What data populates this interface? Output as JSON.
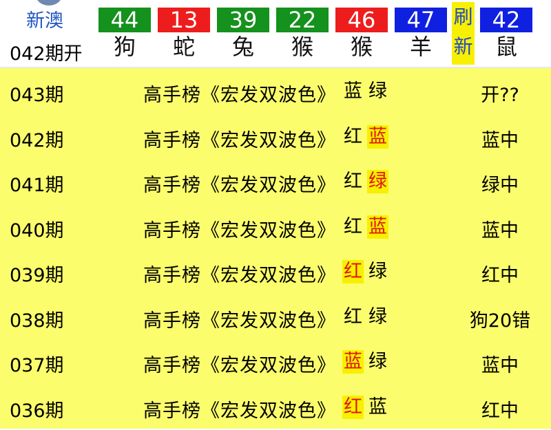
{
  "header": {
    "region": "新澳",
    "issue_open": "042期开",
    "refresh": [
      "刷",
      "新"
    ],
    "balls": [
      {
        "num": "44",
        "zodiac": "狗",
        "color": "#15911d"
      },
      {
        "num": "13",
        "zodiac": "蛇",
        "color": "#ee1d1d"
      },
      {
        "num": "39",
        "zodiac": "兔",
        "color": "#15911d"
      },
      {
        "num": "22",
        "zodiac": "猴",
        "color": "#15911d"
      },
      {
        "num": "46",
        "zodiac": "猴",
        "color": "#ee1d1d"
      },
      {
        "num": "47",
        "zodiac": "羊",
        "color": "#1020e0"
      },
      {
        "num": "42",
        "zodiac": "鼠",
        "color": "#1020e0"
      }
    ]
  },
  "rows": [
    {
      "issue": "043期",
      "prefix": "高手榜《宏发双波色》",
      "opt1": "蓝",
      "opt2": "绿",
      "hit": 0,
      "result": "开??"
    },
    {
      "issue": "042期",
      "prefix": "高手榜《宏发双波色》",
      "opt1": "红",
      "opt2": "蓝",
      "hit": 2,
      "result": "蓝中"
    },
    {
      "issue": "041期",
      "prefix": "高手榜《宏发双波色》",
      "opt1": "红",
      "opt2": "绿",
      "hit": 2,
      "result": "绿中"
    },
    {
      "issue": "040期",
      "prefix": "高手榜《宏发双波色》",
      "opt1": "红",
      "opt2": "蓝",
      "hit": 2,
      "result": "蓝中"
    },
    {
      "issue": "039期",
      "prefix": "高手榜《宏发双波色》",
      "opt1": "红",
      "opt2": "绿",
      "hit": 1,
      "result": "红中"
    },
    {
      "issue": "038期",
      "prefix": "高手榜《宏发双波色》",
      "opt1": "红",
      "opt2": "绿",
      "hit": 0,
      "result": "狗20错"
    },
    {
      "issue": "037期",
      "prefix": "高手榜《宏发双波色》",
      "opt1": "蓝",
      "opt2": "绿",
      "hit": 1,
      "result": "蓝中"
    },
    {
      "issue": "036期",
      "prefix": "高手榜《宏发双波色》",
      "opt1": "红",
      "opt2": "蓝",
      "hit": 1,
      "result": "红中"
    }
  ],
  "colors": {
    "row_bg": "#fbfd6c",
    "highlight_bg": "#f7f000",
    "highlight_text": "#e01515",
    "region_text": "#1f56c2"
  }
}
